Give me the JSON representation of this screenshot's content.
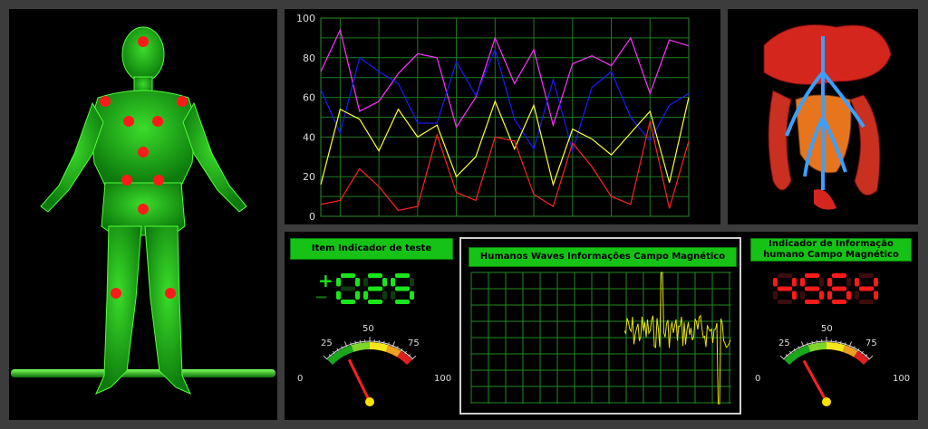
{
  "chart_data": {
    "type": "line",
    "y_ticks": [
      0,
      20,
      40,
      60,
      80,
      100
    ],
    "ylim": [
      0,
      100
    ],
    "grid": true,
    "series": [
      {
        "color": "#ff33ff",
        "values": [
          73,
          94,
          53,
          58,
          72,
          82,
          80,
          45,
          60,
          90,
          67,
          84,
          46,
          77,
          81,
          76,
          90,
          62,
          89,
          86
        ]
      },
      {
        "color": "#1a1aff",
        "values": [
          64,
          42,
          80,
          73,
          67,
          47,
          47,
          78,
          61,
          84,
          49,
          34,
          69,
          33,
          65,
          73,
          50,
          38,
          56,
          62
        ]
      },
      {
        "color": "#ffff33",
        "values": [
          16,
          54,
          49,
          33,
          54,
          40,
          46,
          20,
          30,
          58,
          34,
          56,
          16,
          44,
          39,
          31,
          42,
          53,
          17,
          60
        ]
      },
      {
        "color": "#ff2222",
        "values": [
          6,
          8,
          24,
          15,
          3,
          5,
          41,
          12,
          8,
          40,
          38,
          11,
          5,
          37,
          25,
          10,
          6,
          48,
          4,
          38
        ]
      }
    ]
  },
  "indicator_left": {
    "title": "Item Indicador de teste",
    "display": "025",
    "plus": "+",
    "minus": "−",
    "value": 21
  },
  "indicator_right": {
    "title_line1": "Indicador de Informação",
    "title_line2": "humano Campo Magnético",
    "display": "4564",
    "value": 18
  },
  "gauge_labels": {
    "min": "0",
    "q1": "25",
    "mid": "50",
    "q3": "75",
    "max": "100"
  },
  "waves": {
    "title": "Humanos Waves Informações Campo Magnético",
    "series": [
      {
        "values": [
          0
        ]
      }
    ]
  },
  "colors": {
    "accent": "#16c216",
    "led_green": "#19e619",
    "led_red": "#ff1a1a",
    "background": "#3c3c3c"
  }
}
